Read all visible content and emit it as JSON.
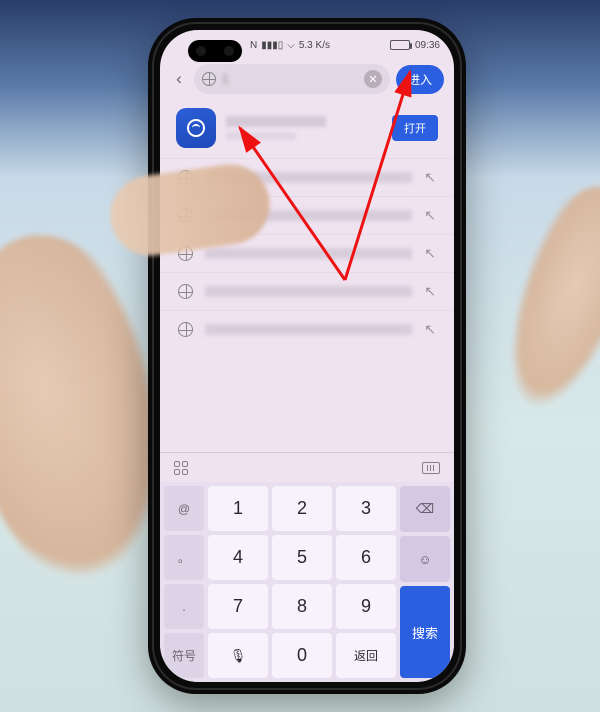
{
  "status_bar": {
    "network_speed": "5.3 K/s",
    "nfc": "N",
    "time": "09:36"
  },
  "address_bar": {
    "typed": "1",
    "enter_label": "进入"
  },
  "featured": {
    "title": "████████",
    "subtitle": "██████",
    "open_label": "打开"
  },
  "suggestions": [
    {
      "text": "1█████████"
    },
    {
      "text": "1████████████"
    },
    {
      "text": "1█████████"
    },
    {
      "text": "1████████"
    },
    {
      "text": "1█████████"
    }
  ],
  "keyboard": {
    "fn_at": "@",
    "fn_dot": "。",
    "fn_period": ".",
    "fn_symbols": "符号",
    "digits": [
      "1",
      "2",
      "3",
      "4",
      "5",
      "6",
      "7",
      "8",
      "9",
      "0"
    ],
    "mic": "🎤",
    "return": "返回",
    "backspace": "⌫",
    "reenter": "⊙",
    "search": "搜索"
  }
}
